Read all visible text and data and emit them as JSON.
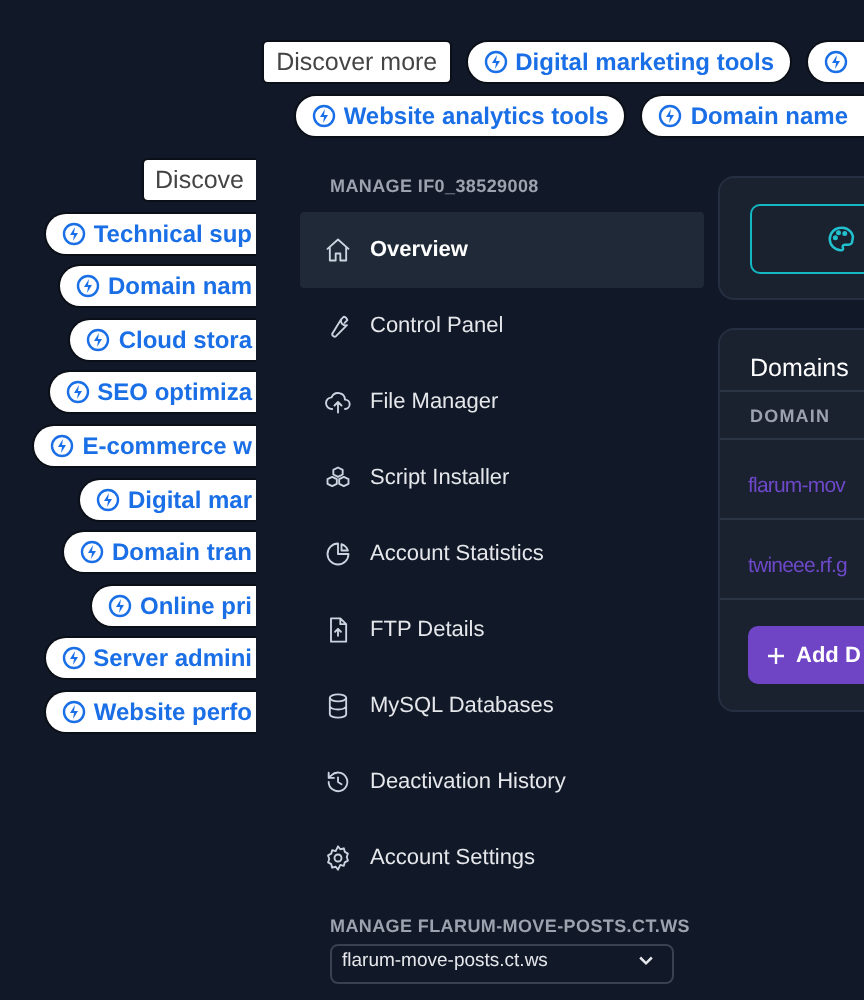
{
  "top_chip_rows": [
    [
      {
        "kind": "heading",
        "label": "Discover more"
      },
      {
        "kind": "link",
        "label": "Digital marketing tools"
      },
      {
        "kind": "link"
      }
    ],
    [
      {
        "kind": "link",
        "label": "Website analytics tools"
      },
      {
        "kind": "link",
        "label": "Domain name"
      }
    ]
  ],
  "side_chips": [
    {
      "kind": "heading",
      "label": "Discove"
    },
    {
      "kind": "link",
      "label": "Technical sup"
    },
    {
      "kind": "link",
      "label": "Domain nam"
    },
    {
      "kind": "link",
      "label": "Cloud stora"
    },
    {
      "kind": "link",
      "label": "SEO optimiza"
    },
    {
      "kind": "link",
      "label": "E-commerce w"
    },
    {
      "kind": "link",
      "label": "Digital mar"
    },
    {
      "kind": "link",
      "label": "Domain tran"
    },
    {
      "kind": "link",
      "label": "Online pri"
    },
    {
      "kind": "link",
      "label": "Server admini"
    },
    {
      "kind": "link",
      "label": "Website perfo"
    }
  ],
  "sidebar": {
    "heading": "MANAGE IF0_38529008",
    "items": [
      {
        "label": "Overview",
        "selected": true
      },
      {
        "label": "Control Panel",
        "selected": false
      },
      {
        "label": "File Manager",
        "selected": false
      },
      {
        "label": "Script Installer",
        "selected": false
      },
      {
        "label": "Account Statistics",
        "selected": false
      },
      {
        "label": "FTP Details",
        "selected": false
      },
      {
        "label": "MySQL Databases",
        "selected": false
      },
      {
        "label": "Deactivation History",
        "selected": false
      },
      {
        "label": "Account Settings",
        "selected": false
      }
    ],
    "section_heading": "MANAGE FLARUM-MOVE-POSTS.CT.WS",
    "domain_select": {
      "value": "flarum-move-posts.ct.ws"
    }
  },
  "domains_card": {
    "title": "Domains",
    "column": "DOMAIN",
    "rows": [
      "flarum-mov",
      "twineee.rf.g"
    ],
    "add_button": "Add D"
  }
}
